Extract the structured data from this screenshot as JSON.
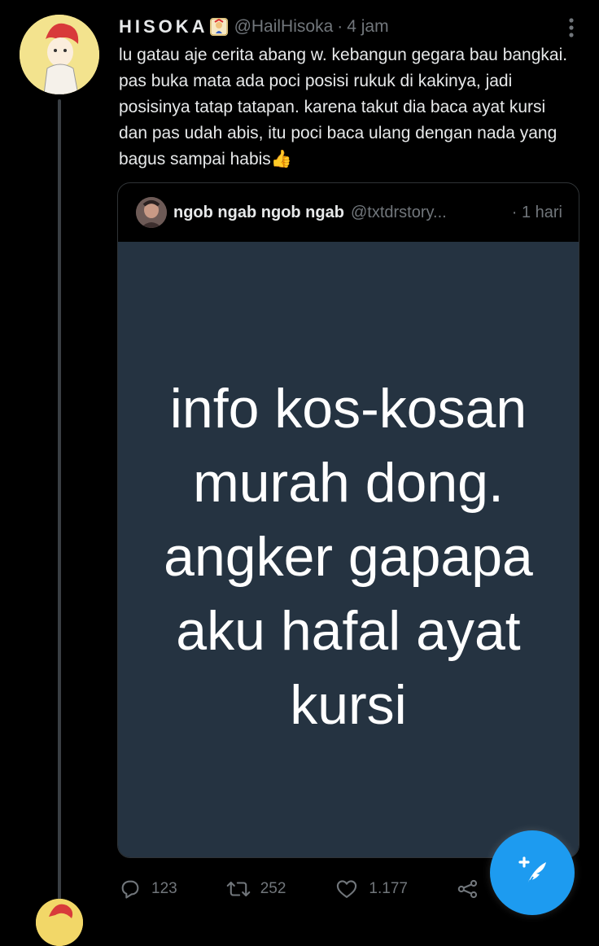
{
  "tweet": {
    "display_name": "HISOKA",
    "handle": "@HailHisoka",
    "separator": "·",
    "time": "4 jam",
    "text": "lu gatau aje cerita abang w. kebangun gegara bau bangkai. pas buka mata ada poci posisi rukuk di kakinya, jadi posisinya tatap tatapan. karena takut dia baca ayat kursi dan pas udah abis, itu poci baca ulang dengan nada yang bagus sampai habis👍"
  },
  "quote": {
    "display_name": "ngob ngab ngob ngab",
    "handle": "@txtdrstory...",
    "time": "· 1 hari",
    "media_text": "info kos-kosan murah dong. angker gapapa aku hafal ayat kursi"
  },
  "actions": {
    "replies": "123",
    "retweets": "252",
    "likes": "1.177"
  },
  "colors": {
    "background": "#000000",
    "accent": "#1d9bf0",
    "muted_text": "#71767b",
    "media_background": "#253341"
  },
  "icons": [
    "more-vertical-icon",
    "reply-icon",
    "retweet-icon",
    "like-icon",
    "share-icon",
    "compose-tweet-icon"
  ]
}
